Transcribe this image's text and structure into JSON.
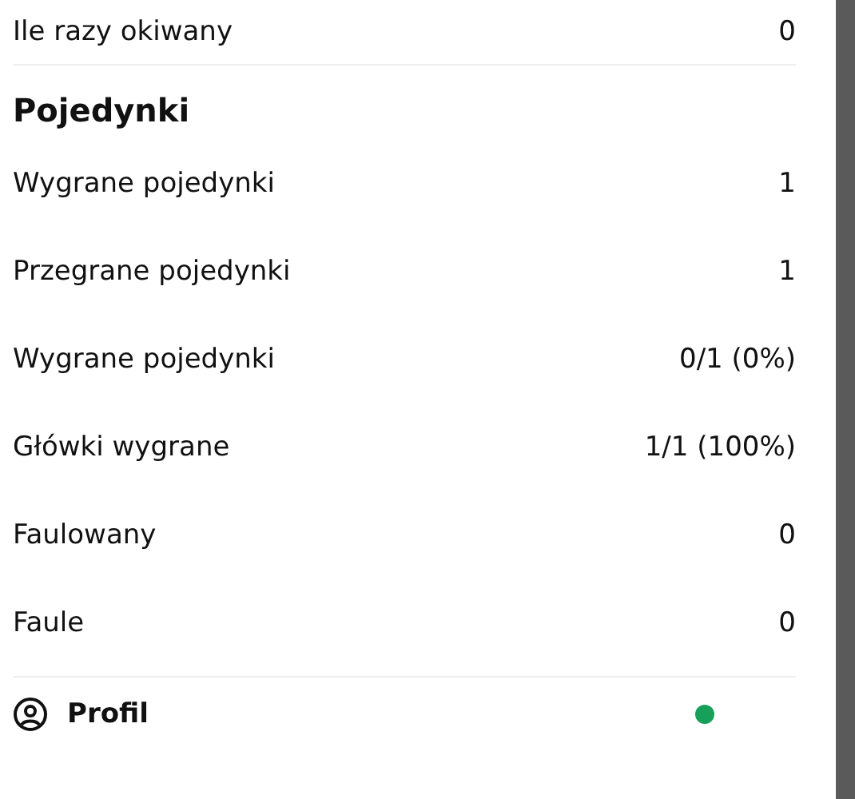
{
  "top_row": {
    "label": "Ile razy okiwany",
    "value": "0"
  },
  "section": {
    "title": "Pojedynki",
    "rows": [
      {
        "label": "Wygrane pojedynki",
        "value": "1"
      },
      {
        "label": "Przegrane pojedynki",
        "value": "1"
      },
      {
        "label": "Wygrane pojedynki",
        "value": "0/1 (0%)"
      },
      {
        "label": "Główki wygrane",
        "value": "1/1 (100%)"
      },
      {
        "label": "Faulowany",
        "value": "0"
      },
      {
        "label": "Faule",
        "value": "0"
      }
    ]
  },
  "footer": {
    "label": "Profil"
  }
}
